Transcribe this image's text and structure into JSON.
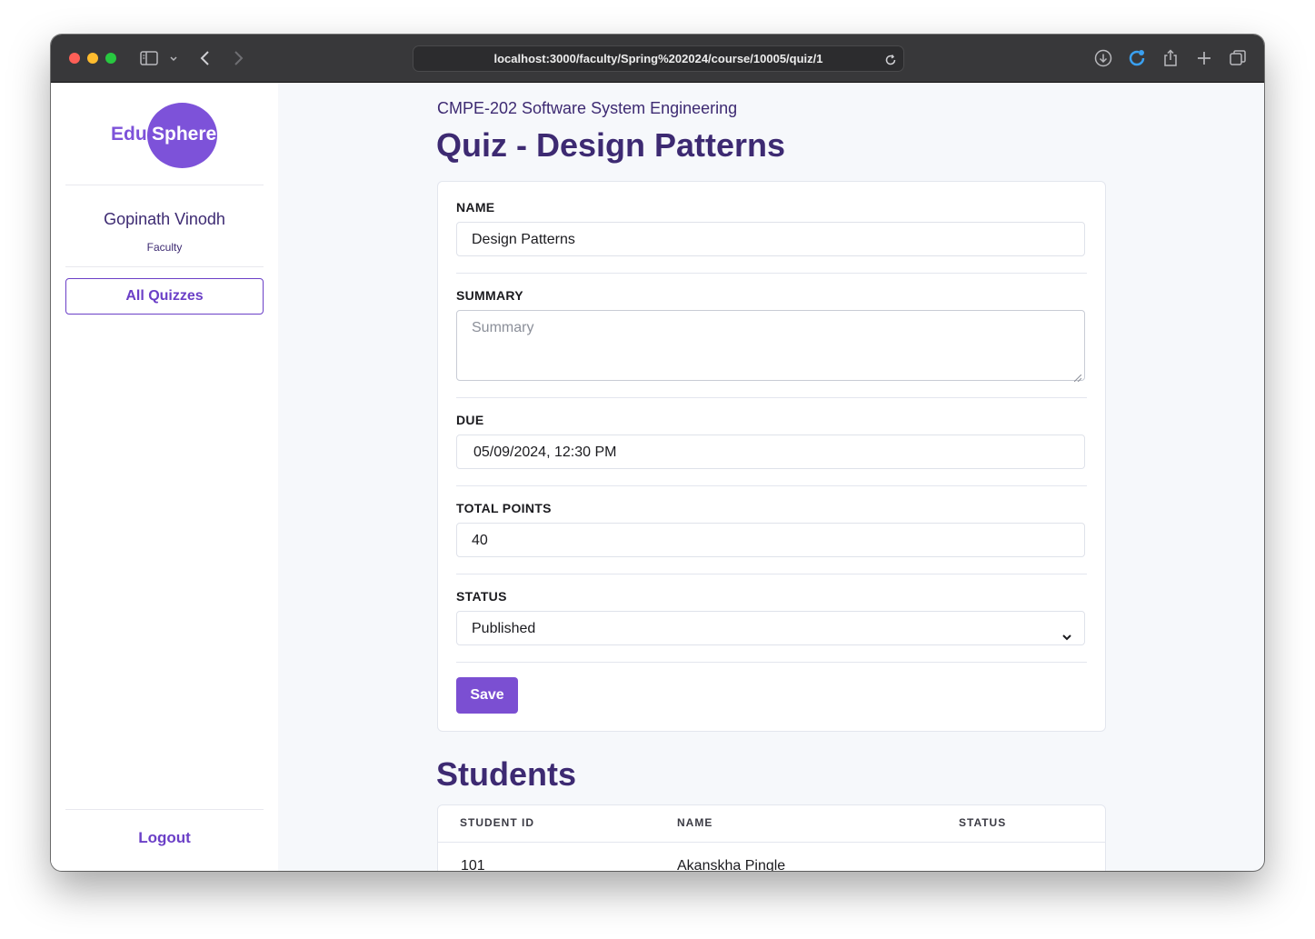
{
  "browser": {
    "url": "localhost:3000/faculty/Spring%202024/course/10005/quiz/1",
    "traffic_light_colors": [
      "#fe5f57",
      "#febc2e",
      "#28c840"
    ]
  },
  "sidebar": {
    "logo": {
      "part1": "Edu",
      "part2": "Sphere"
    },
    "user_name": "Gopinath Vinodh",
    "user_role": "Faculty",
    "nav_button": "All Quizzes",
    "logout": "Logout"
  },
  "main": {
    "course_title": "CMPE-202 Software System Engineering",
    "page_title": "Quiz - Design Patterns",
    "form": {
      "name_label": "NAME",
      "name_value": "Design Patterns",
      "summary_label": "SUMMARY",
      "summary_placeholder": "Summary",
      "due_label": "DUE",
      "due_value": "05/09/2024, 12:30 PM",
      "points_label": "TOTAL POINTS",
      "points_value": "40",
      "status_label": "STATUS",
      "status_value": "Published",
      "save_label": "Save"
    },
    "students": {
      "title": "Students",
      "columns": [
        "STUDENT ID",
        "NAME",
        "STATUS"
      ],
      "rows": [
        {
          "id": "101",
          "name": "Akanskha Pingle",
          "status": ""
        }
      ]
    }
  },
  "colors": {
    "accent": "#7b4fd2",
    "heading": "#3d2a72",
    "background": "#f6f8fb"
  }
}
